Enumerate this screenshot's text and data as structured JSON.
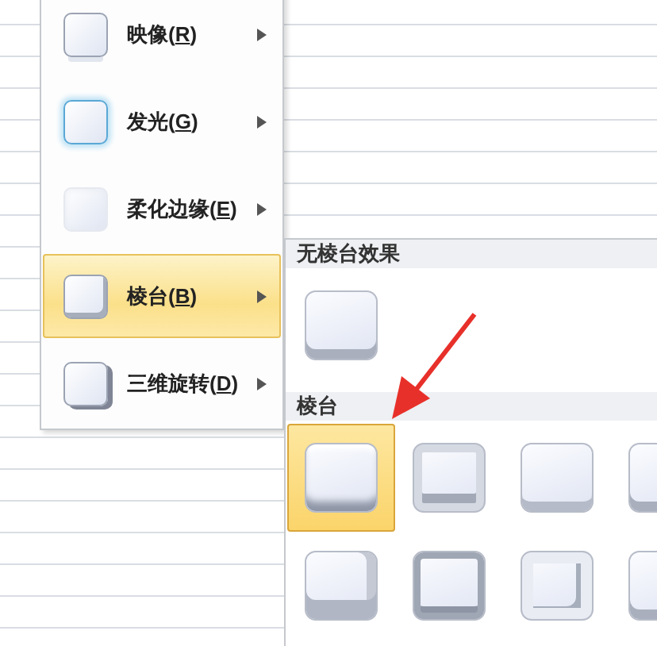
{
  "menu": {
    "items": [
      {
        "kind": "reflection",
        "label": "映像(",
        "mnemonic": "R",
        "label_end": ")",
        "selected": false
      },
      {
        "kind": "glow",
        "label": "发光(",
        "mnemonic": "G",
        "label_end": ")",
        "selected": false
      },
      {
        "kind": "soft-edges",
        "label": "柔化边缘(",
        "mnemonic": "E",
        "label_end": ")",
        "selected": false
      },
      {
        "kind": "bevel",
        "label": "棱台(",
        "mnemonic": "B",
        "label_end": ")",
        "selected": true
      },
      {
        "kind": "rotation",
        "label": "三维旋转(",
        "mnemonic": "D",
        "label_end": ")",
        "selected": false
      }
    ]
  },
  "submenu": {
    "sections": [
      {
        "title": "无棱台效果",
        "tiles": [
          {
            "kind": "plain",
            "selected": false
          }
        ]
      },
      {
        "title": "棱台",
        "tiles": [
          {
            "kind": "circle",
            "selected": true
          },
          {
            "kind": "relaxed-inset",
            "selected": false
          },
          {
            "kind": "cross",
            "selected": false
          },
          {
            "kind": "cool-slant",
            "selected": false
          },
          {
            "kind": "angle",
            "selected": false
          },
          {
            "kind": "soft-round",
            "selected": false
          },
          {
            "kind": "convex",
            "selected": false
          },
          {
            "kind": "slope",
            "selected": false
          }
        ]
      }
    ]
  }
}
